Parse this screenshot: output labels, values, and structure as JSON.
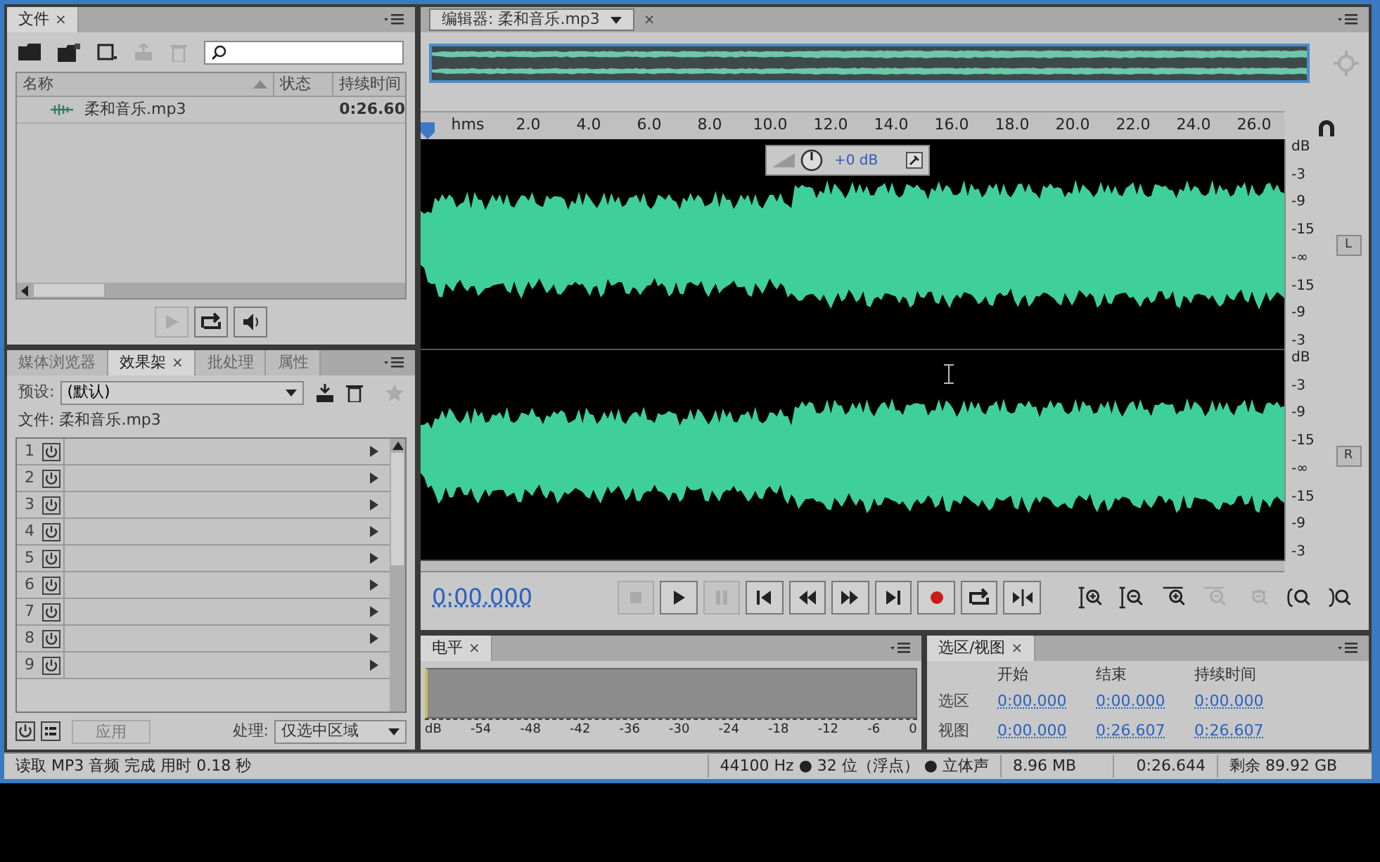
{
  "files_panel": {
    "tab": "文件",
    "close": "×",
    "columns": [
      "名称",
      "状态",
      "持续时间"
    ],
    "rows": [
      {
        "name": "柔和音乐.mp3",
        "status": "",
        "duration": "0:26.60",
        "selected": false
      }
    ]
  },
  "effects_panel": {
    "tabs": [
      {
        "label": "媒体浏览器",
        "selected": false
      },
      {
        "label": "效果架",
        "selected": true
      },
      {
        "label": "批处理",
        "selected": false
      },
      {
        "label": "属性",
        "selected": false
      }
    ],
    "close": "×",
    "preset_label": "预设:",
    "preset_value": "(默认)",
    "file_line": "文件: 柔和音乐.mp3",
    "slots": [
      "1",
      "2",
      "3",
      "4",
      "5",
      "6",
      "7",
      "8",
      "9"
    ],
    "apply_button": {
      "label": "应用",
      "disabled": true
    },
    "process_label": "处理:",
    "process_value": "仅选中区域"
  },
  "editor": {
    "tab": "编辑器: 柔和音乐.mp3",
    "close": "×",
    "ruler_labels": [
      "hms",
      "2.0",
      "4.0",
      "6.0",
      "8.0",
      "10.0",
      "12.0",
      "14.0",
      "16.0",
      "18.0",
      "20.0",
      "22.0",
      "24.0",
      "26.0"
    ],
    "volume_hud": "+0 dB",
    "channels": [
      {
        "button": "L",
        "scale": [
          "dB",
          "-3",
          "-9",
          "-15",
          "-∞",
          "-15",
          "-9",
          "-3"
        ]
      },
      {
        "button": "R",
        "scale": [
          "dB",
          "-3",
          "-9",
          "-15",
          "-∞",
          "-15",
          "-9",
          "-3"
        ]
      }
    ],
    "time": "0:00.000",
    "transport": [
      {
        "kind": "stop",
        "disabled": true
      },
      {
        "kind": "play",
        "disabled": false
      },
      {
        "kind": "pause",
        "disabled": true
      },
      {
        "kind": "start",
        "disabled": false
      },
      {
        "kind": "rewind",
        "disabled": false
      },
      {
        "kind": "forward",
        "disabled": false
      },
      {
        "kind": "end",
        "disabled": false
      },
      {
        "kind": "record",
        "disabled": false
      },
      {
        "kind": "loop",
        "disabled": false
      },
      {
        "kind": "skip",
        "disabled": false
      }
    ],
    "zoom": [
      {
        "kind": "zoom-in-amp",
        "disabled": false
      },
      {
        "kind": "zoom-out-amp",
        "disabled": false
      },
      {
        "kind": "zoom-in-time",
        "disabled": false
      },
      {
        "kind": "zoom-out-full",
        "disabled": true
      },
      {
        "kind": "zoom-selection",
        "disabled": true
      },
      {
        "kind": "zoom-in-point",
        "disabled": false
      },
      {
        "kind": "zoom-out-point",
        "disabled": false
      }
    ]
  },
  "level_panel": {
    "tab": "电平",
    "close": "×",
    "scale": [
      "dB",
      "-54",
      "-48",
      "-42",
      "-36",
      "-30",
      "-24",
      "-18",
      "-12",
      "-6",
      "0"
    ]
  },
  "selection_panel": {
    "tab": "选区/视图",
    "close": "×",
    "columns": [
      "开始",
      "结束",
      "持续时间"
    ],
    "rows": [
      {
        "label": "选区",
        "values": [
          "0:00.000",
          "0:00.000",
          "0:00.000"
        ]
      },
      {
        "label": "视图",
        "values": [
          "0:00.000",
          "0:26.607",
          "0:26.607"
        ]
      }
    ]
  },
  "status_bar": {
    "message": "读取 MP3 音频 完成 用时 0.18 秒",
    "format": "44100 Hz ● 32 位（浮点） ● 立体声",
    "size": "8.96 MB",
    "duration": "0:26.644",
    "free": "剩余 89.92 GB"
  }
}
